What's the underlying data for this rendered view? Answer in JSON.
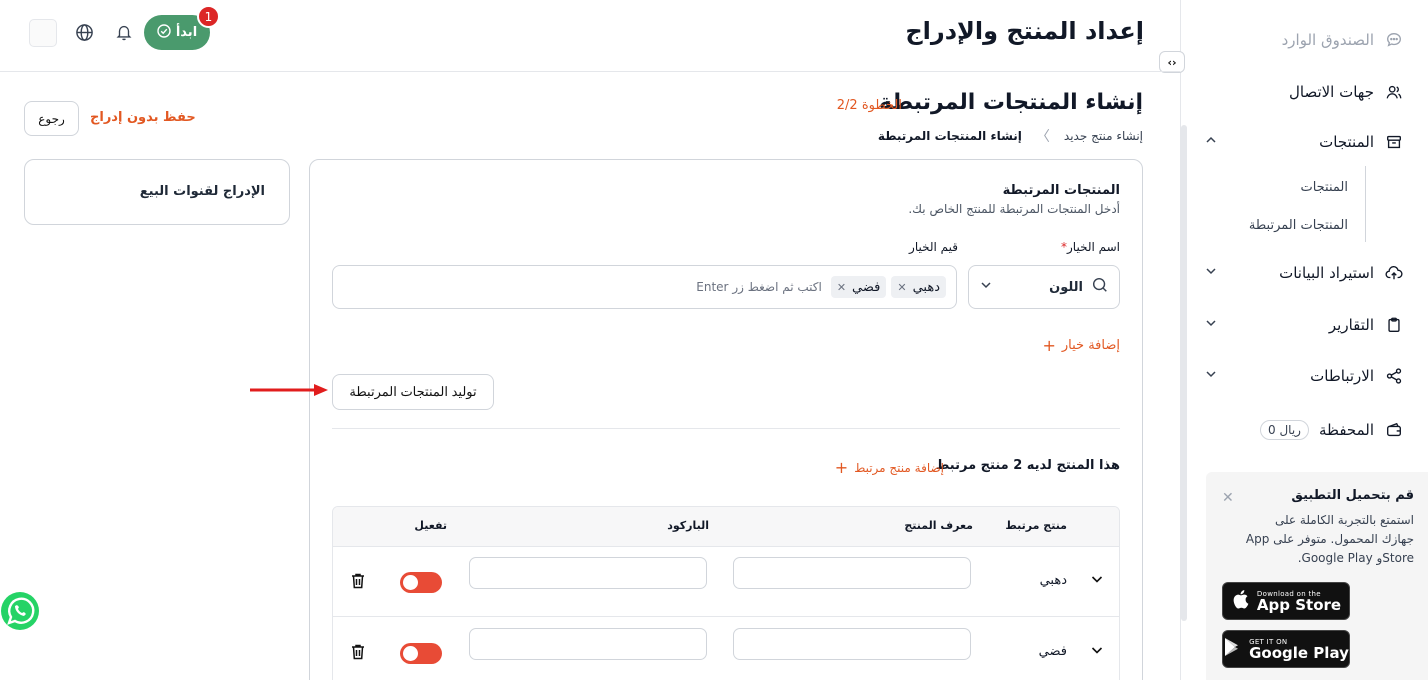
{
  "topbar": {
    "title": "إعداد المنتج والإدراج",
    "start_label": "ابدأ",
    "notification_count": "1"
  },
  "sidebar": {
    "items": [
      {
        "label": "الصندوق الوارد"
      },
      {
        "label": "جهات الاتصال"
      },
      {
        "label": "المنتجات"
      },
      {
        "label": "استيراد البيانات"
      },
      {
        "label": "التقارير"
      },
      {
        "label": "الارتباطات"
      },
      {
        "label": "المحفظة"
      }
    ],
    "sub_items": [
      "المنتجات",
      "المنتجات المرتبطة"
    ],
    "wallet_amount": "0 ريال"
  },
  "promo": {
    "title": "قم بتحميل التطبيق",
    "text": "استمتع بالتجربة الكاملة على جهازك المحمول. متوفر على App Storeو Google Play.",
    "appstore_small": "Download on the",
    "appstore_big": "App Store",
    "googleplay_small": "GET IT ON",
    "googleplay_big": "Google Play"
  },
  "header": {
    "section_title": "إنشاء المنتجات المرتبطة",
    "step": "الخطوة 2/2",
    "breadcrumb": [
      "إنشاء منتج جديد",
      "إنشاء المنتجات المرتبطة"
    ],
    "save_draft": "حفظ بدون إدراج",
    "back": "رجوع"
  },
  "channels": {
    "title": "الإدراج لقنوات البيع"
  },
  "form": {
    "heading": "المنتجات المرتبطة",
    "description": "أدخل المنتجات المرتبطة للمنتج الخاص بك.",
    "option_label": "اسم الخيار",
    "option_required_mark": "*",
    "values_label": "قيم الخيار",
    "option_value": "اللون",
    "chips": [
      "دهبي",
      "فضي"
    ],
    "values_placeholder": "اكتب ثم اضغط زر Enter",
    "add_option": "إضافة خيار",
    "generate_button": "توليد المنتجات المرتبطة",
    "count_text": "هذا المنتج لديه 2 منتج مرتبط",
    "add_variant": "إضافة منتج مرتبط"
  },
  "table": {
    "headers": [
      "منتج مرتبط",
      "معرف المنتج",
      "الباركود",
      "تفعيل"
    ],
    "rows": [
      {
        "name": "دهبي",
        "product_id": "",
        "barcode": "",
        "active": true
      },
      {
        "name": "فضي",
        "product_id": "",
        "barcode": "",
        "active": true
      }
    ]
  },
  "colors": {
    "accent": "#e25822",
    "start_button": "#4a9a6d",
    "toggle_on": "#e84b36",
    "badge": "#dc2626"
  }
}
